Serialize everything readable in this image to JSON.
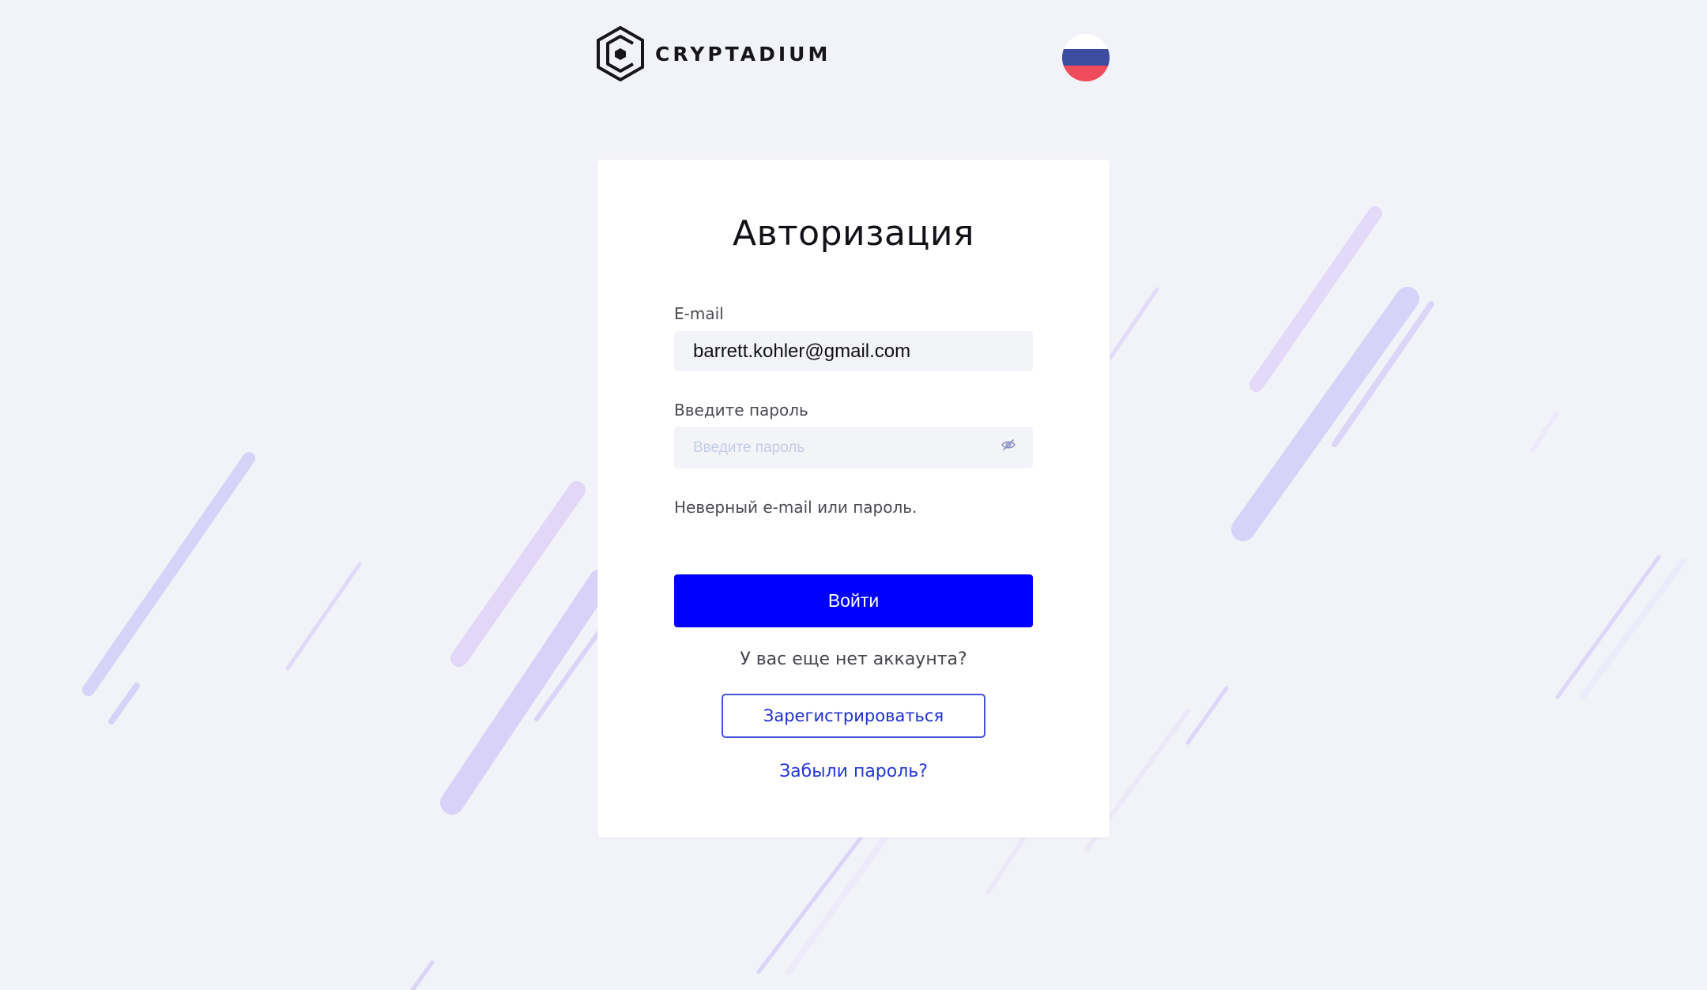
{
  "brand": {
    "name": "CRYPTADIUM",
    "logo_icon": "hexagon-c-logo"
  },
  "language": {
    "flag": "russia-flag",
    "colors": [
      "#ffffff",
      "#3c4da0",
      "#ef4b5a"
    ]
  },
  "auth_card": {
    "title": "Авторизация",
    "email_label": "E-mail",
    "email_value": "barrett.kohler@gmail.com",
    "password_label": "Введите пароль",
    "password_placeholder": "Введите пароль",
    "password_toggle_icon": "eye-slash-icon",
    "error_message": "Неверный e-mail или пароль.",
    "login_label": "Войти",
    "no_account_text": "У вас еще нет аккаунта?",
    "register_label": "Зарегистрироваться",
    "forgot_label": "Забыли пароль?"
  },
  "colors": {
    "background": "#f2f3f8",
    "card": "#ffffff",
    "primary": "#0000ff",
    "link": "#2438d6",
    "field": "#f3f4f8",
    "decor_stripes": "#d9d5fa"
  }
}
